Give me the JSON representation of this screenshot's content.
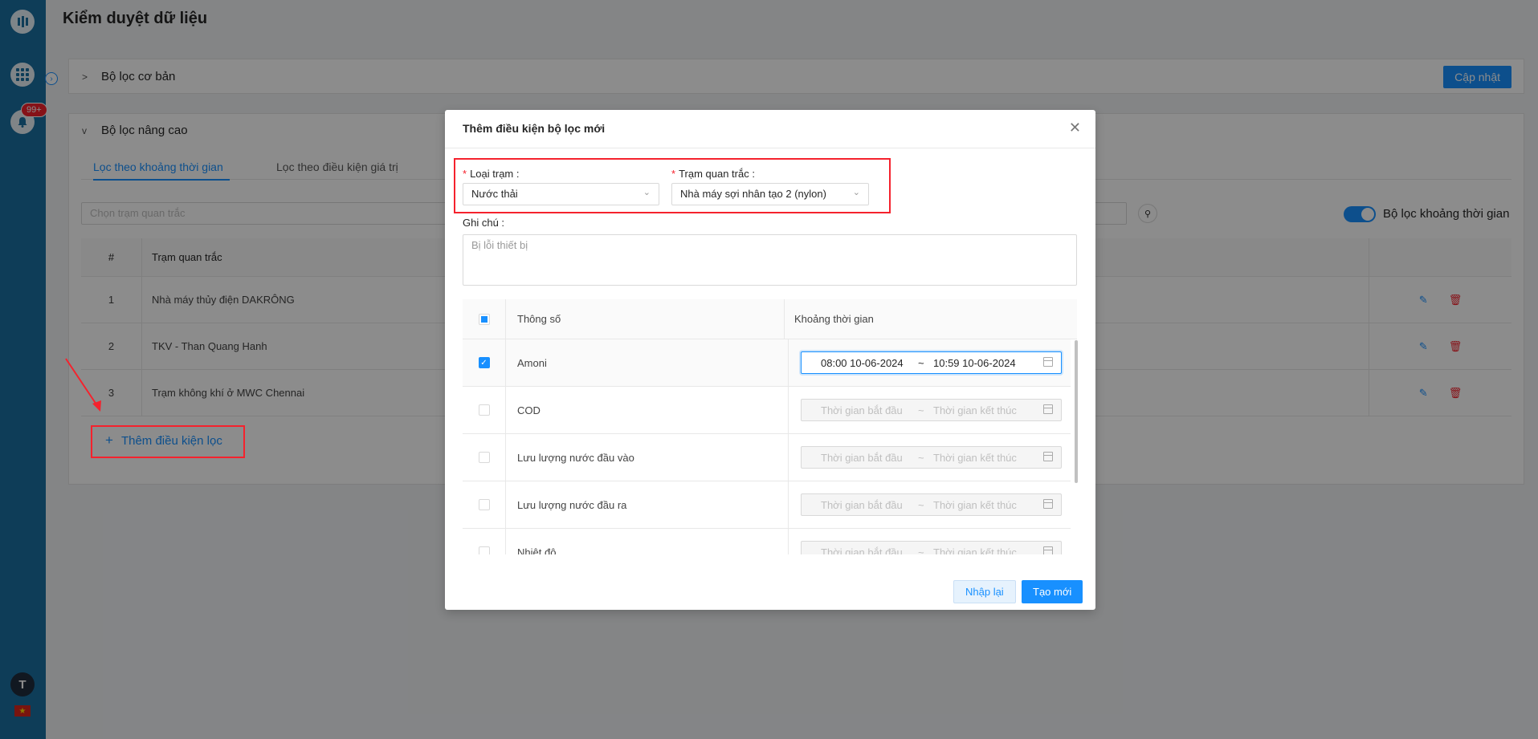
{
  "sidebar": {
    "notification_badge": "99+",
    "avatar_letter": "T"
  },
  "page": {
    "title": "Kiểm duyệt dữ liệu"
  },
  "basic_filter": {
    "title": "Bộ lọc cơ bản",
    "update_button": "Cập nhật"
  },
  "advanced_filter": {
    "title": "Bộ lọc nâng cao",
    "tabs": [
      "Lọc theo khoảng thời gian",
      "Lọc theo điều kiện giá trị"
    ],
    "station_placeholder": "Chọn trạm quan trắc",
    "toggle_label": "Bộ lọc khoảng thời gian",
    "table": {
      "headers": [
        "#",
        "Trạm quan trắc"
      ],
      "rows": [
        {
          "num": "1",
          "name": "Nhà máy thủy điện DAKRÔNG"
        },
        {
          "num": "2",
          "name": "TKV - Than Quang Hanh"
        },
        {
          "num": "3",
          "name": "Trạm không khí ở MWC Chennai"
        }
      ]
    },
    "add_button": "Thêm điều kiện lọc"
  },
  "modal": {
    "title": "Thêm điều kiện bộ lọc mới",
    "station_type_label": "Loại trạm",
    "station_type_value": "Nước thải",
    "station_label": "Trạm quan trắc",
    "station_value": "Nhà máy sợi nhân tạo 2 (nylon)",
    "note_label": "Ghi chú",
    "note_value": "Bị lỗi thiết bị",
    "table": {
      "col_param": "Thông số",
      "col_range": "Khoảng thời gian",
      "start_placeholder": "Thời gian bắt đầu",
      "end_placeholder": "Thời gian kết thúc",
      "rows": [
        {
          "name": "Amoni",
          "checked": true,
          "start": "08:00 10-06-2024",
          "end": "10:59 10-06-2024"
        },
        {
          "name": "COD",
          "checked": false
        },
        {
          "name": "Lưu lượng nước đầu vào",
          "checked": false
        },
        {
          "name": "Lưu lượng nước đầu ra",
          "checked": false
        },
        {
          "name": "Nhiệt độ",
          "checked": false
        }
      ]
    },
    "reset_button": "Nhập lại",
    "create_button": "Tạo mới"
  },
  "colors": {
    "primary": "#1890ff",
    "sidebar": "#1b6fa0",
    "highlight": "#f5222d"
  }
}
